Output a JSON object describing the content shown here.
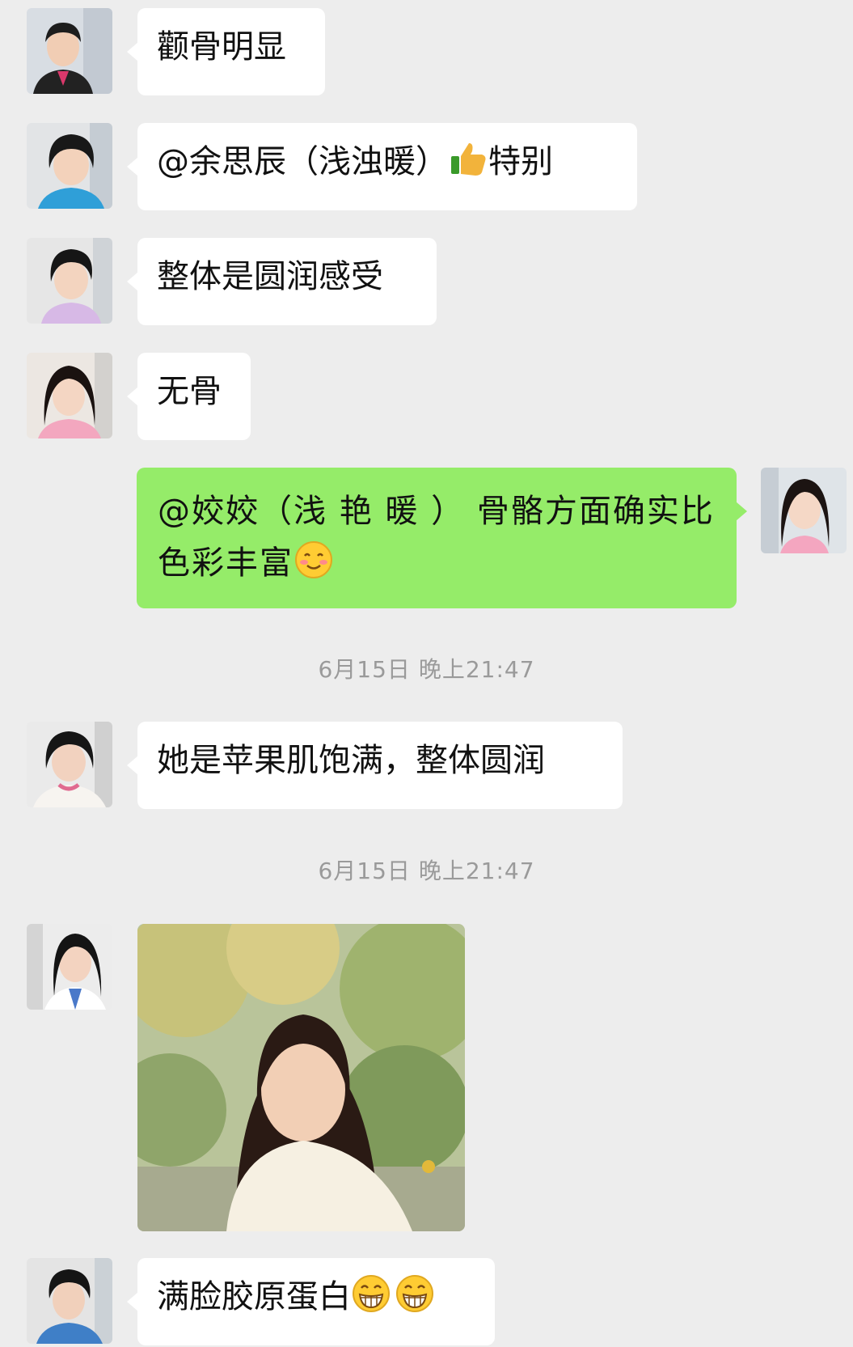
{
  "messages": [
    {
      "text": "颧骨明显"
    },
    {
      "text_before": "@余思辰（浅浊暖）",
      "text_after": "特别",
      "emoji": "thumbs-up"
    },
    {
      "text": "整体是圆润感受"
    },
    {
      "text": "无骨"
    },
    {
      "text": "@姣姣（浅 艳 暖 ） 骨骼方面确实比色彩丰富",
      "emoji": "blushing-smile"
    },
    {
      "text": "她是苹果肌饱满，整体圆润"
    },
    {
      "image": "portrait-photo"
    },
    {
      "text": "满脸胶原蛋白",
      "emoji": "grinning-face"
    }
  ],
  "timestamps": [
    "6月15日 晚上21:47",
    "6月15日 晚上21:47"
  ],
  "colors": {
    "background": "#ededed",
    "incoming_bubble": "#ffffff",
    "outgoing_bubble": "#95ec69",
    "timestamp_text": "#9a9a9a"
  }
}
